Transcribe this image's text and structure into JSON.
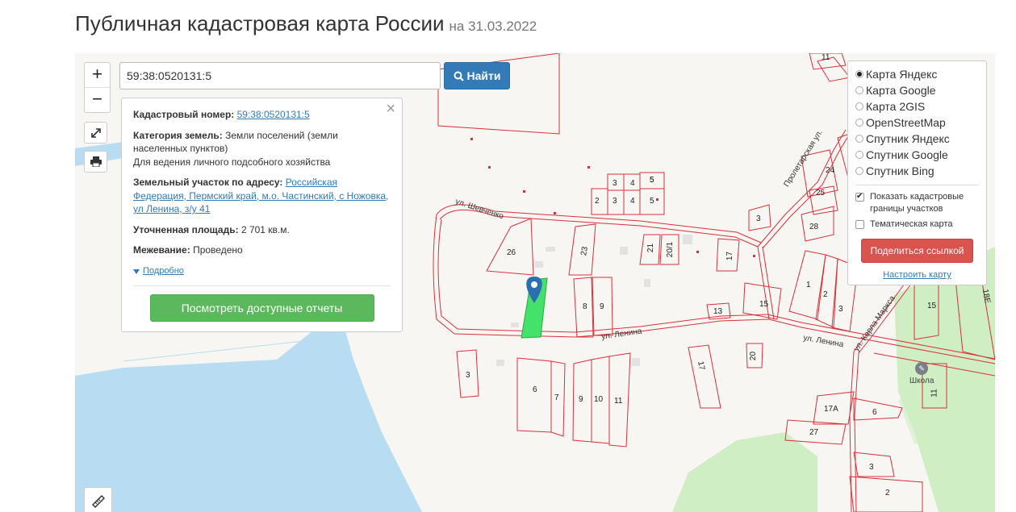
{
  "header": {
    "title": "Публичная кадастровая карта России",
    "date": "на 31.03.2022"
  },
  "colors": {
    "accent_blue": "#337ab7",
    "green_button": "#5cb85c",
    "red_button": "#d9534f",
    "parcel_border": "#d9303a",
    "selected_parcel": "#44e26a",
    "water": "#b8dcf2",
    "green_area": "#cfeec4"
  },
  "map": {
    "zoom_in": "+",
    "zoom_out": "−",
    "search_value": "59:38:0520131:5",
    "search_button": "Найти",
    "school_label": "Школа",
    "streets": [
      "ул. Шевченко",
      "ул. Ленина",
      "ул. Ленина",
      "Пролетарская ул.",
      "ул. Карла Маркса"
    ],
    "parcel_numbers": [
      "11",
      "5",
      "3",
      "4",
      "5",
      "2",
      "3",
      "4",
      "5",
      "3",
      "26",
      "23",
      "21",
      "20/1",
      "17",
      "28",
      "25",
      "25",
      "24",
      "26",
      "1",
      "2",
      "3",
      "8",
      "9",
      "13",
      "15",
      "3",
      "6",
      "7",
      "9",
      "10",
      "11",
      "20",
      "17",
      "17А",
      "6",
      "27",
      "3",
      "2",
      "15",
      "18Е",
      "11"
    ]
  },
  "info": {
    "cadastral_label": "Кадастровый номер:",
    "cadastral_value": "59:38:0520131:5",
    "category_label": "Категория земель:",
    "category_value": "Земли поселений (земли населенных пунктов)",
    "usage": "Для ведения личного подсобного хозяйства",
    "address_label": "Земельный участок по адресу:",
    "address_value": "Российская Федерация, Пермский край, м.о. Частинский, с Ножовка, ул Ленина, з/у 41",
    "area_label": "Уточненная площадь:",
    "area_value": "2 701 кв.м.",
    "survey_label": "Межевание:",
    "survey_value": "Проведено",
    "more": "Подробно",
    "reports_button": "Посмотреть доступные отчеты"
  },
  "layers": {
    "options": [
      {
        "label": "Карта Яндекс",
        "selected": true
      },
      {
        "label": "Карта Google",
        "selected": false
      },
      {
        "label": "Карта 2GIS",
        "selected": false
      },
      {
        "label": "OpenStreetMap",
        "selected": false
      },
      {
        "label": "Спутник Яндекс",
        "selected": false
      },
      {
        "label": "Спутник Google",
        "selected": false
      },
      {
        "label": "Спутник Bing",
        "selected": false
      }
    ],
    "show_borders": "Показать кадастровые границы участков",
    "thematic": "Тематическая карта",
    "share_button": "Поделиться ссылкой",
    "setup_link": "Настроить карту"
  }
}
